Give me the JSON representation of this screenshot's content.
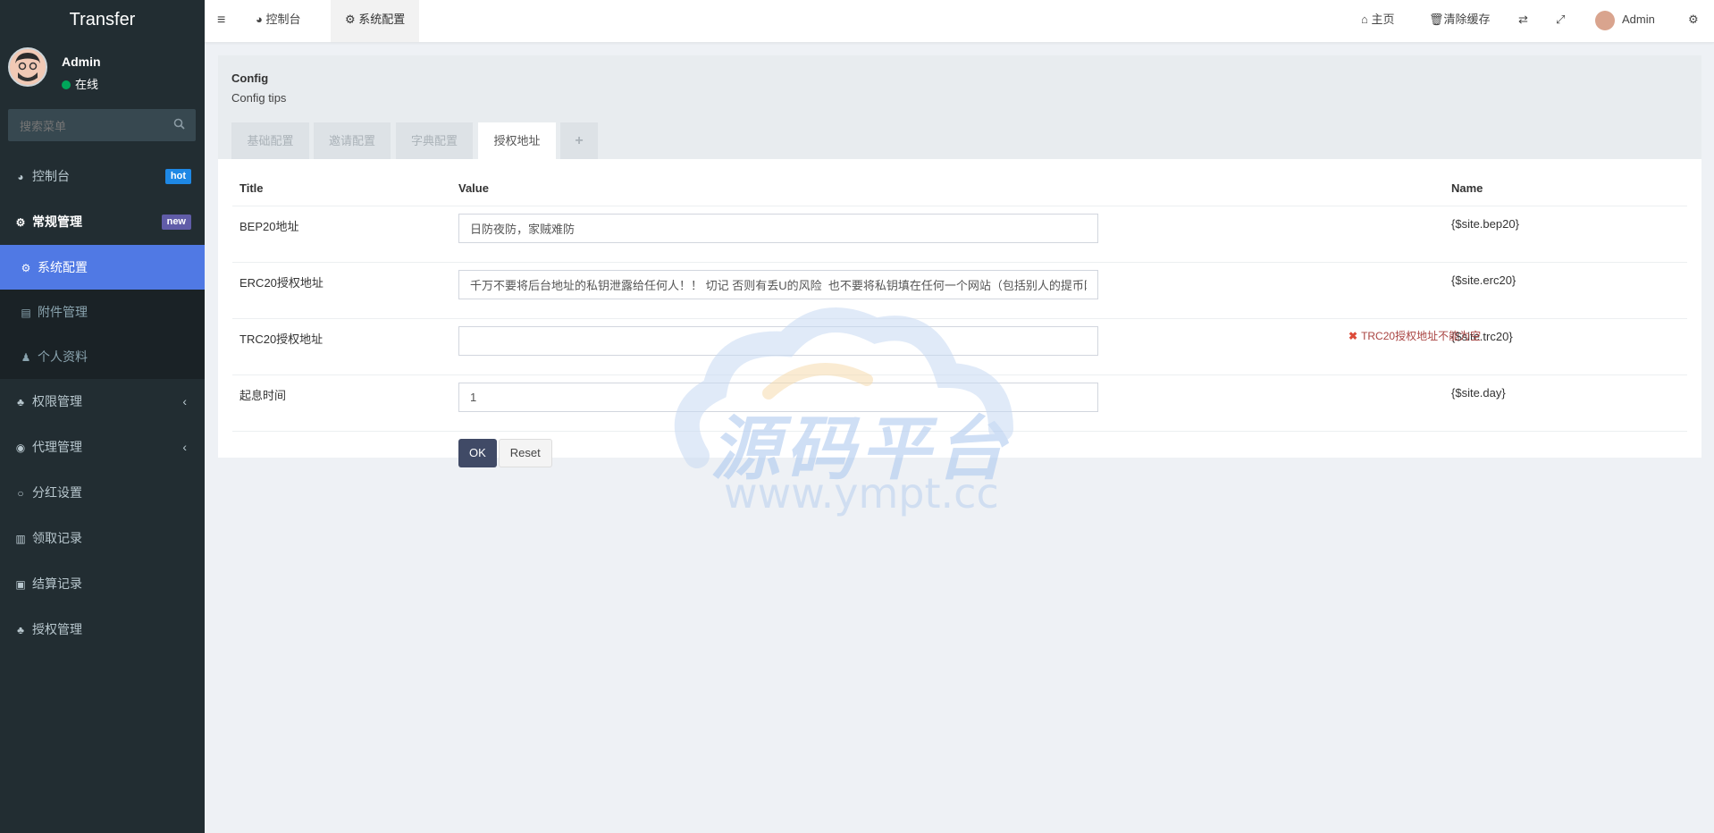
{
  "app": {
    "brand": "Transfer"
  },
  "user": {
    "name": "Admin",
    "status": "在线"
  },
  "search": {
    "placeholder": "搜索菜单"
  },
  "menu": {
    "dashboard": {
      "label": "控制台",
      "badge": "hot"
    },
    "general": {
      "label": "常规管理",
      "badge": "new"
    },
    "sub": {
      "system_config": "系统配置",
      "attachments": "附件管理",
      "profile": "个人资料"
    },
    "permissions": "权限管理",
    "agents": "代理管理",
    "dividend": "分红设置",
    "claims": "领取记录",
    "settlement": "结算记录",
    "authorization": "授权管理"
  },
  "topbar": {
    "tabs": [
      {
        "label": "控制台"
      },
      {
        "label": "系统配置"
      }
    ],
    "home": "主页",
    "clear_cache": "清除缓存",
    "admin": "Admin"
  },
  "config": {
    "title": "Config",
    "tips": "Config tips",
    "tabs": [
      "基础配置",
      "邀请配置",
      "字典配置",
      "授权地址"
    ],
    "add_tab": "+",
    "columns": {
      "title": "Title",
      "value": "Value",
      "name": "Name"
    },
    "rows": [
      {
        "title": "BEP20地址",
        "value": "日防夜防，家贼难防",
        "name": "{$site.bep20}"
      },
      {
        "title": "ERC20授权地址",
        "value": "千万不要将后台地址的私钥泄露给任何人！！ 切记 否则有丢U的风险  也不要将私钥填在任何一个网站（包括别人的提币网站）",
        "name": "{$site.erc20}"
      },
      {
        "title": "TRC20授权地址",
        "value": "",
        "name": "{$site.trc20}",
        "error": "TRC20授权地址不能为空"
      },
      {
        "title": "起息时间",
        "value": "1",
        "name": "{$site.day}"
      }
    ],
    "ok": "OK",
    "reset": "Reset"
  },
  "watermark": {
    "text": "源码平台",
    "url": "www.ympt.cc"
  },
  "colors": {
    "sidebar": "#222d32",
    "active": "#5079e4",
    "ok_button": "#404a66",
    "error": "#a94442"
  }
}
